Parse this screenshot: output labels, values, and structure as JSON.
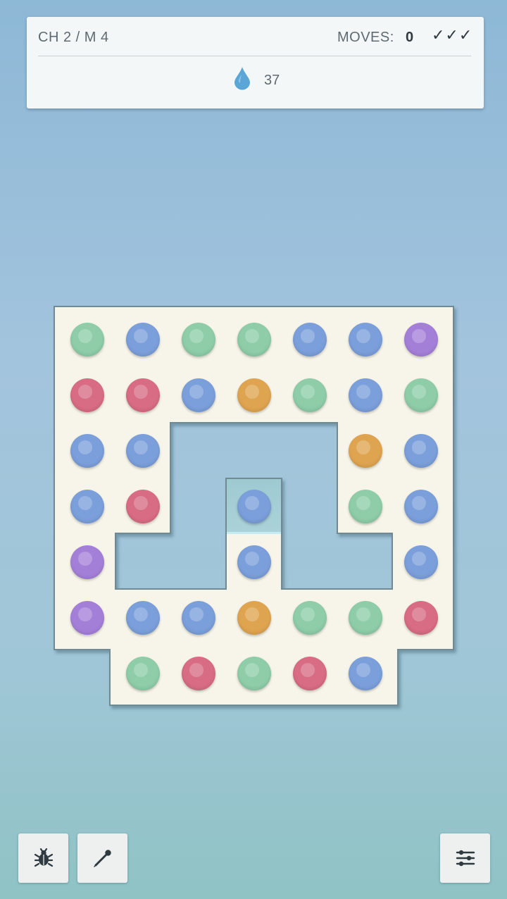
{
  "header": {
    "level": "CH 2 / M 4",
    "moves_label": "MOVES:",
    "moves_count": "0",
    "stars": "✓✓✓",
    "drops_count": "37"
  },
  "colors": {
    "G": "#8ecda8",
    "B": "#7b9fdb",
    "P": "#a47fd8",
    "R": "#d86c84",
    "O": "#dfa450",
    "board": "#f7f5e9",
    "board_border": "#6f8a94"
  },
  "board": {
    "rows": [
      [
        "G",
        "B",
        "G",
        "G",
        "B",
        "B",
        "P"
      ],
      [
        "R",
        "R",
        "B",
        "O",
        "G",
        "B",
        "G"
      ],
      [
        "B",
        "B",
        "",
        "",
        "",
        "O",
        "B"
      ],
      [
        "B",
        "R",
        "",
        "B",
        "",
        "G",
        "B"
      ],
      [
        "P",
        "",
        "",
        "B",
        "",
        "",
        "B"
      ],
      [
        "P",
        "B",
        "B",
        "O",
        "G",
        "G",
        "R"
      ],
      [
        "",
        "G",
        "R",
        "G",
        "R",
        "B",
        ""
      ]
    ],
    "selected": {
      "row": 3,
      "col": 3
    }
  },
  "toolbar": {
    "bug_icon": "bug-icon",
    "pin_icon": "pin-icon",
    "settings_icon": "sliders-icon"
  }
}
